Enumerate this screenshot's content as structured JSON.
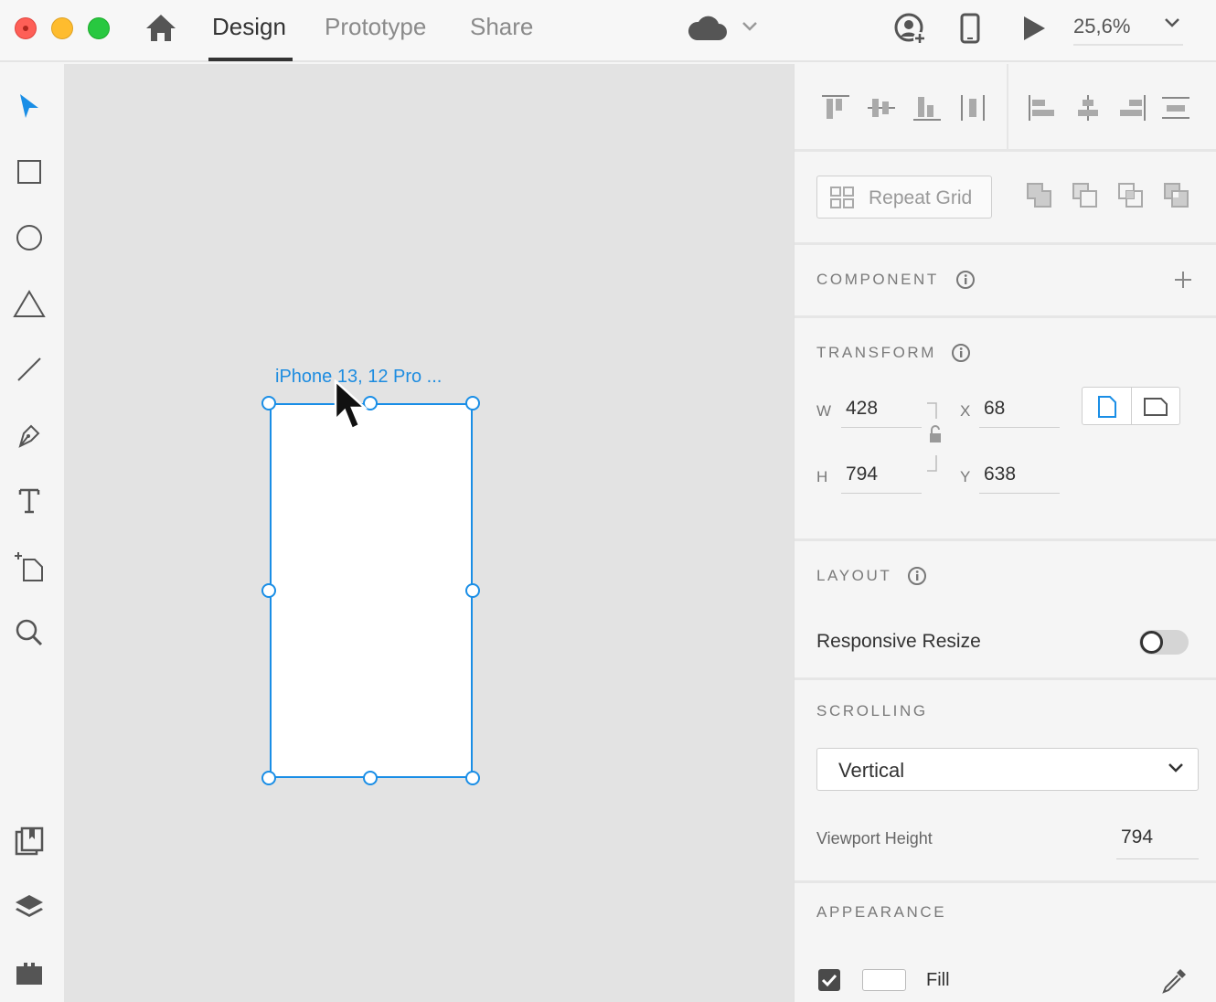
{
  "window": {
    "tabs": [
      {
        "label": "Design",
        "active": true
      },
      {
        "label": "Prototype",
        "active": false
      },
      {
        "label": "Share",
        "active": false
      }
    ],
    "zoom": "25,6%",
    "icons": [
      "home-icon",
      "cloud-icon",
      "chevron-down-icon",
      "share-user-icon",
      "mobile-preview-icon",
      "play-icon"
    ]
  },
  "tools": [
    "select-tool",
    "rectangle-tool",
    "ellipse-tool",
    "polygon-tool",
    "line-tool",
    "pen-tool",
    "text-tool",
    "artboard-tool",
    "zoom-tool",
    "assets-panel",
    "layers-panel",
    "plugins-panel"
  ],
  "canvas": {
    "artboard_label": "iPhone 13, 12 Pro ..."
  },
  "panel": {
    "repeat_grid_label": "Repeat Grid",
    "component": {
      "title": "COMPONENT"
    },
    "transform": {
      "title": "TRANSFORM",
      "w_label": "W",
      "w": "428",
      "h_label": "H",
      "h": "794",
      "x_label": "X",
      "x": "68",
      "y_label": "Y",
      "y": "638"
    },
    "layout": {
      "title": "LAYOUT",
      "responsive_resize_label": "Responsive Resize",
      "responsive_resize_on": false
    },
    "scrolling": {
      "title": "SCROLLING",
      "selected": "Vertical",
      "viewport_height_label": "Viewport Height",
      "viewport_height": "794"
    },
    "appearance": {
      "title": "APPEARANCE",
      "fill_label": "Fill",
      "fill_checked": true,
      "fill_color": "#ffffff"
    }
  },
  "colors": {
    "accent": "#1a8ee6",
    "canvas": "#e3e3e3",
    "panel": "#f5f5f5"
  }
}
